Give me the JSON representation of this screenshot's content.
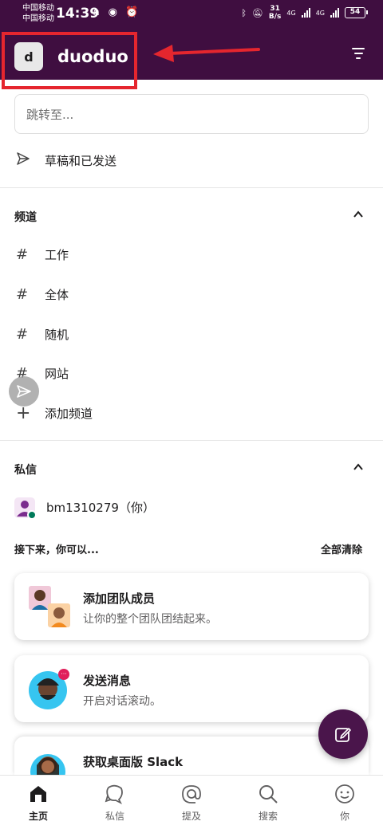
{
  "status_bar": {
    "carrier_1": "中国移动",
    "carrier_2": "中国移动",
    "time": "14:39",
    "left_icons": "∩ ◉ ⏰",
    "net_speed_value": "31",
    "net_speed_unit": "B/s",
    "signal_1_label": "4G",
    "signal_2_label": "4G",
    "battery": "54"
  },
  "header": {
    "workspace_initial": "d",
    "workspace_name": "duoduo",
    "highlight_color": "#e5262e"
  },
  "search": {
    "placeholder": "跳转至..."
  },
  "drafts": {
    "label": "草稿和已发送"
  },
  "channels": {
    "title": "频道",
    "items": [
      {
        "prefix": "#",
        "label": "工作"
      },
      {
        "prefix": "#",
        "label": "全体"
      },
      {
        "prefix": "#",
        "label": "随机"
      },
      {
        "prefix": "#",
        "label": "网站"
      }
    ],
    "add_label": "添加频道",
    "add_prefix": "+"
  },
  "dms": {
    "title": "私信",
    "user": "bm1310279（你）"
  },
  "next_steps": {
    "title": "接下来，你可以...",
    "clear_all": "全部清除",
    "cards": [
      {
        "title": "添加团队成员",
        "desc": "让你的整个团队团结起来。"
      },
      {
        "title": "发送消息",
        "desc": "开启对话滚动。"
      },
      {
        "title": "获取桌面版 Slack",
        "desc": ""
      }
    ]
  },
  "tabs": [
    {
      "label": "主页",
      "icon": "home-icon"
    },
    {
      "label": "私信",
      "icon": "dm-icon"
    },
    {
      "label": "提及",
      "icon": "mention-icon"
    },
    {
      "label": "搜索",
      "icon": "search-icon"
    },
    {
      "label": "你",
      "icon": "you-icon"
    }
  ],
  "colors": {
    "brand": "#3f0e40",
    "fab": "#4a154b",
    "presence": "#007a5a"
  }
}
